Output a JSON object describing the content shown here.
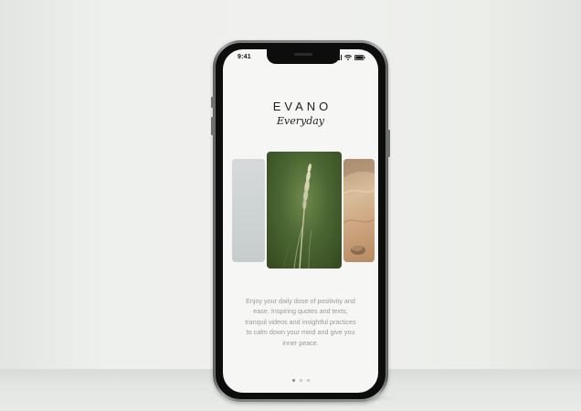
{
  "status_bar": {
    "time": "9:41",
    "icons": [
      "signal-icon",
      "wifi-icon",
      "battery-icon"
    ]
  },
  "app": {
    "brand": "EVANO",
    "tagline": "Everyday"
  },
  "carousel": {
    "cards": [
      {
        "name": "mist-card",
        "image": "pale grey sky"
      },
      {
        "name": "grass-card",
        "image": "grass stalk on green background"
      },
      {
        "name": "sand-card",
        "image": "sand and rock"
      }
    ]
  },
  "onboarding": {
    "description": "Enjoy your daily dose of positivity and ease. Inspiring quotes and texts, tranquil videos and insightful practices to calm down your mind and give you inner peace.",
    "page_count": 3,
    "active_page": 1
  },
  "colors": {
    "screen_background": "#f6f6f5",
    "text_primary": "#1e1e1e",
    "text_secondary": "#9a9a9a",
    "dot_active": "#8a8a8a",
    "dot_inactive": "#c6c6c6"
  }
}
